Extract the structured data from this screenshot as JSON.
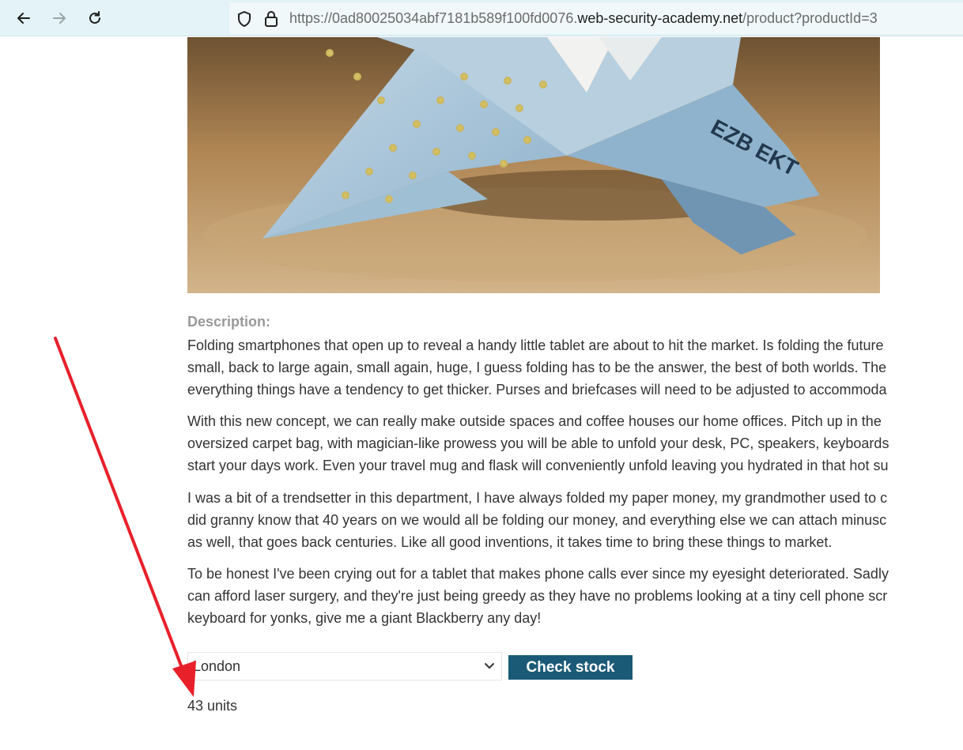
{
  "browser": {
    "url_prefix": "https://0ad80025034abf7181b589f100fd0076.",
    "url_host": "web-security-academy.net",
    "url_path": "/product?productId=3",
    "icons": [
      "back-arrow-icon",
      "forward-arrow-icon",
      "reload-icon",
      "shield-icon",
      "lock-icon"
    ]
  },
  "product": {
    "image_alt": "Origami money folding",
    "description_label": "Description:",
    "paragraphs": [
      [
        "Folding smartphones that open up to reveal a handy little tablet are about to hit the market. Is folding the future",
        "small, back to large again, small again, huge, I guess folding has to be the answer, the best of both worlds. The",
        "everything things have a tendency to get thicker. Purses and briefcases will need to be adjusted to accommoda"
      ],
      [
        "With this new concept, we can really make outside spaces and coffee houses our home offices. Pitch up in the",
        "oversized carpet bag, with magician-like prowess you will be able to unfold your desk, PC, speakers, keyboards",
        "start your days work. Even your travel mug and flask will conveniently unfold leaving you hydrated in that hot su"
      ],
      [
        "I was a bit of a trendsetter in this department, I have always folded my paper money, my grandmother used to c",
        "did granny know that 40 years on we would all be folding our money, and everything else we can attach minusc",
        "as well, that goes back centuries. Like all good inventions, it takes time to bring these things to market."
      ],
      [
        "To be honest I've been crying out for a tablet that makes phone calls ever since my eyesight deteriorated. Sadly",
        "can afford laser surgery, and they're just being greedy as they have no problems looking at a tiny cell phone scr",
        "keyboard for yonks, give me a giant Blackberry any day!"
      ]
    ]
  },
  "stock_check": {
    "selected_store": "London",
    "button_label": "Check stock",
    "result": "43 units"
  },
  "colors": {
    "button_bg": "#1b5a77",
    "label_gray": "#999999",
    "annotation_red": "#e8202a"
  }
}
